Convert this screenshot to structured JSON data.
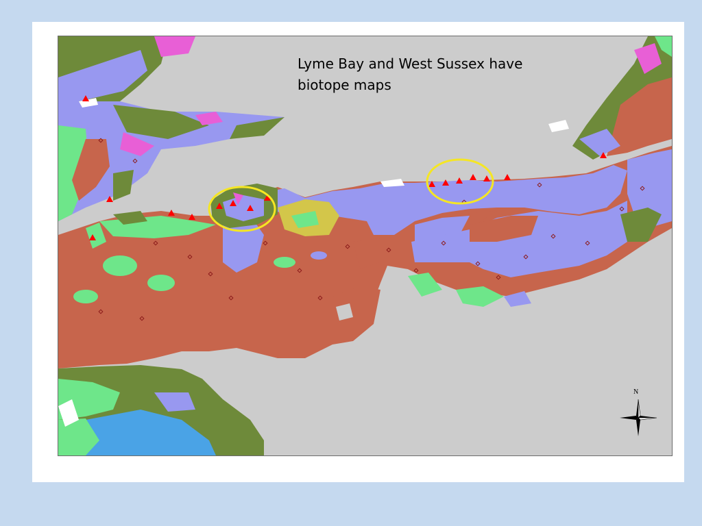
{
  "map": {
    "caption_lines": [
      "Lyme Bay and West Sussex have",
      "biotope maps"
    ],
    "north_label": "N",
    "colors": {
      "background": "#c5d9ef",
      "land": "#cccccc",
      "sediment": "#c7654c",
      "sand": "#9898f0",
      "mixed": "#6e8a3a",
      "reef": "#e85fd6",
      "coarse": "#6ee68a",
      "gravel": "#d3c64a",
      "deep": "#4aa3e6",
      "highlight_circle": "#f5e623",
      "record_triangle": "#ff0000",
      "record_diamond": "#8b1a1a"
    },
    "highlighted_areas": [
      "Lyme Bay",
      "West Sussex"
    ]
  }
}
